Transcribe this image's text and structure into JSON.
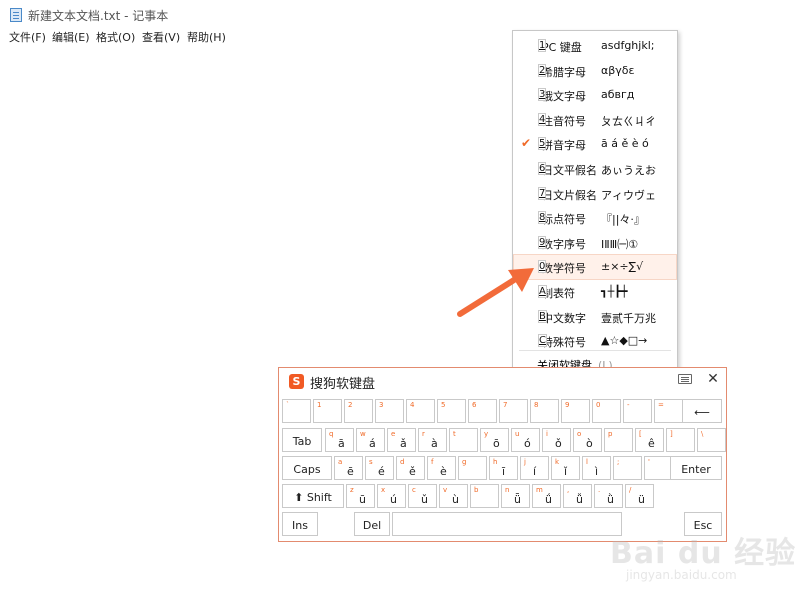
{
  "window": {
    "title": "新建文本文档.txt - 记事本"
  },
  "menubar": [
    "文件(F)",
    "编辑(E)",
    "格式(O)",
    "查看(V)",
    "帮助(H)"
  ],
  "symbol_menu": {
    "items": [
      {
        "key": "1",
        "label": "PC 键盘",
        "sample": "asdfghjkl;",
        "checked": false
      },
      {
        "key": "2",
        "label": "希腊字母",
        "sample": "αβγδε",
        "checked": false
      },
      {
        "key": "3",
        "label": "俄文字母",
        "sample": "абвгд",
        "checked": false
      },
      {
        "key": "4",
        "label": "注音符号",
        "sample": "ㄆㄊㄍㄐㄔ",
        "checked": false
      },
      {
        "key": "5",
        "label": "拼音字母",
        "sample": "ā á ě è ó",
        "checked": true
      },
      {
        "key": "6",
        "label": "日文平假名",
        "sample": "あぃうえお",
        "checked": false
      },
      {
        "key": "7",
        "label": "日文片假名",
        "sample": "アィウヴェ",
        "checked": false
      },
      {
        "key": "8",
        "label": "标点符号",
        "sample": "『||々·』",
        "checked": false
      },
      {
        "key": "9",
        "label": "数字序号",
        "sample": "ⅠⅡⅢ㈠①",
        "checked": false
      },
      {
        "key": "0",
        "label": "数学符号",
        "sample": "±×÷∑√",
        "checked": false,
        "hover": true
      },
      {
        "key": "A",
        "label": "制表符",
        "sample": "┓┼┣┿",
        "checked": false
      },
      {
        "key": "B",
        "label": "中文数字",
        "sample": "壹贰千万兆",
        "checked": false
      },
      {
        "key": "C",
        "label": "特殊符号",
        "sample": "▲☆◆□→",
        "checked": false
      }
    ],
    "close_label": "关闭软键盘",
    "close_shortcut": "(L)",
    "check_mark": "✔"
  },
  "soft_keyboard": {
    "title": "搜狗软键盘",
    "logo": "S",
    "close": "✕",
    "row1": [
      {
        "top": "`",
        "main": ""
      },
      {
        "top": "1",
        "main": ""
      },
      {
        "top": "2",
        "main": ""
      },
      {
        "top": "3",
        "main": ""
      },
      {
        "top": "4",
        "main": ""
      },
      {
        "top": "5",
        "main": ""
      },
      {
        "top": "6",
        "main": ""
      },
      {
        "top": "7",
        "main": ""
      },
      {
        "top": "8",
        "main": ""
      },
      {
        "top": "9",
        "main": ""
      },
      {
        "top": "0",
        "main": ""
      },
      {
        "top": "-",
        "main": ""
      },
      {
        "top": "=",
        "main": ""
      }
    ],
    "backspace": "⟵",
    "tab": "Tab",
    "row2": [
      {
        "top": "q",
        "main": "ā"
      },
      {
        "top": "w",
        "main": "á"
      },
      {
        "top": "e",
        "main": "ǎ"
      },
      {
        "top": "r",
        "main": "à"
      },
      {
        "top": "t",
        "main": ""
      },
      {
        "top": "y",
        "main": "ō"
      },
      {
        "top": "u",
        "main": "ó"
      },
      {
        "top": "i",
        "main": "ǒ"
      },
      {
        "top": "o",
        "main": "ò"
      },
      {
        "top": "p",
        "main": ""
      },
      {
        "top": "[",
        "main": "ê"
      },
      {
        "top": "]",
        "main": ""
      },
      {
        "top": "\\",
        "main": ""
      }
    ],
    "caps": "Caps",
    "row3": [
      {
        "top": "a",
        "main": "ē"
      },
      {
        "top": "s",
        "main": "é"
      },
      {
        "top": "d",
        "main": "ě"
      },
      {
        "top": "f",
        "main": "è"
      },
      {
        "top": "g",
        "main": ""
      },
      {
        "top": "h",
        "main": "ī"
      },
      {
        "top": "j",
        "main": "í"
      },
      {
        "top": "k",
        "main": "ǐ"
      },
      {
        "top": "l",
        "main": "ì"
      },
      {
        "top": ";",
        "main": ""
      },
      {
        "top": "'",
        "main": ""
      }
    ],
    "enter": "Enter",
    "shift": "⬆ Shift",
    "row4": [
      {
        "top": "z",
        "main": "ū"
      },
      {
        "top": "x",
        "main": "ú"
      },
      {
        "top": "c",
        "main": "ǔ"
      },
      {
        "top": "v",
        "main": "ù"
      },
      {
        "top": "b",
        "main": ""
      },
      {
        "top": "n",
        "main": "ǖ"
      },
      {
        "top": "m",
        "main": "ǘ"
      },
      {
        "top": ",",
        "main": "ǚ"
      },
      {
        "top": ".",
        "main": "ǜ"
      },
      {
        "top": "/",
        "main": "ü"
      }
    ],
    "ins": "Ins",
    "del": "Del",
    "esc": "Esc"
  },
  "watermark": {
    "text": "Bai du 经验",
    "sub": "jingyan.baidu.com"
  },
  "colors": {
    "accent": "#f06a28",
    "arrow": "#f26b3a"
  }
}
